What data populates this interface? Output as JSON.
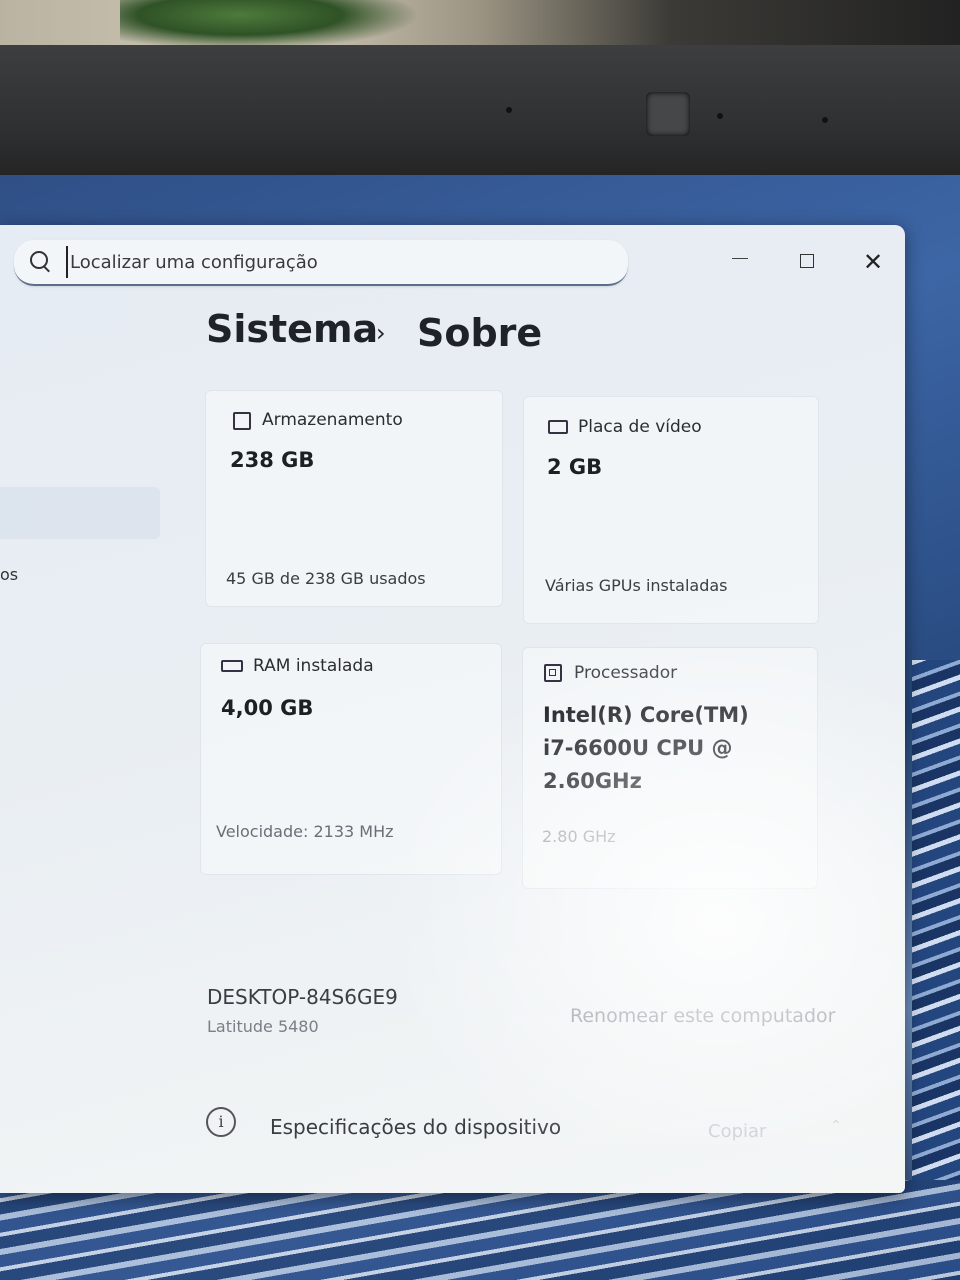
{
  "search": {
    "placeholder": "Localizar uma configuração"
  },
  "window_controls": {
    "close_glyph": "✕"
  },
  "breadcrumb": {
    "parent": "Sistema",
    "separator": "›",
    "current": "Sobre"
  },
  "sidebar": {
    "fragment": "os"
  },
  "cards": {
    "storage": {
      "title": "Armazenamento",
      "value": "238 GB",
      "sub": "45 GB de 238 GB usados"
    },
    "gpu": {
      "title": "Placa de vídeo",
      "value": "2 GB",
      "sub": "Várias GPUs instaladas"
    },
    "ram": {
      "title": "RAM instalada",
      "value": "4,00 GB",
      "sub": "Velocidade: 2133 MHz"
    },
    "cpu": {
      "title": "Processador",
      "value_line1": "Intel(R) Core(TM)",
      "value_line2": "i7-6600U CPU @",
      "value_line3": "2.60GHz",
      "sub": "2.80 GHz"
    }
  },
  "device": {
    "name": "DESKTOP-84S6GE9",
    "model": "Latitude 5480",
    "rename_label": "Renomear este computador"
  },
  "specs": {
    "info_glyph": "i",
    "label": "Especificações do dispositivo",
    "copy_label": "Copiar",
    "chevron": "⌃"
  }
}
